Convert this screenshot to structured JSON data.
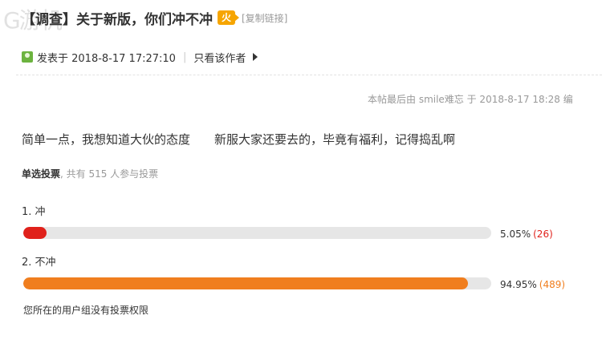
{
  "watermark": "G游机",
  "thread": {
    "title": "【调查】关于新版，你们冲不冲",
    "hot_badge": "火",
    "copy_link": "[复制链接]"
  },
  "meta": {
    "posted_at": "发表于 2018-8-17 17:27:10",
    "separator": "|",
    "only_author": "只看该作者"
  },
  "edit_note": "本帖最后由 smile难忘 于 2018-8-17 18:28 编",
  "post": {
    "line1": "简单一点，我想知道大伙的态度",
    "line2": "新服大家还要去的，毕竟有福利，记得捣乱啊"
  },
  "poll": {
    "type_label": "单选投票",
    "summary": ", 共有 515 人参与投票",
    "options": [
      {
        "label": "1.  冲",
        "percent_text": "5.05%",
        "count_text": "(26)",
        "fraction": 0.0505,
        "color": "#e0211b"
      },
      {
        "label": "2.  不冲",
        "percent_text": "94.95%",
        "count_text": "(489)",
        "fraction": 0.9495,
        "color": "#f07e1e"
      }
    ],
    "no_permission": "您所在的用户组没有投票权限"
  }
}
